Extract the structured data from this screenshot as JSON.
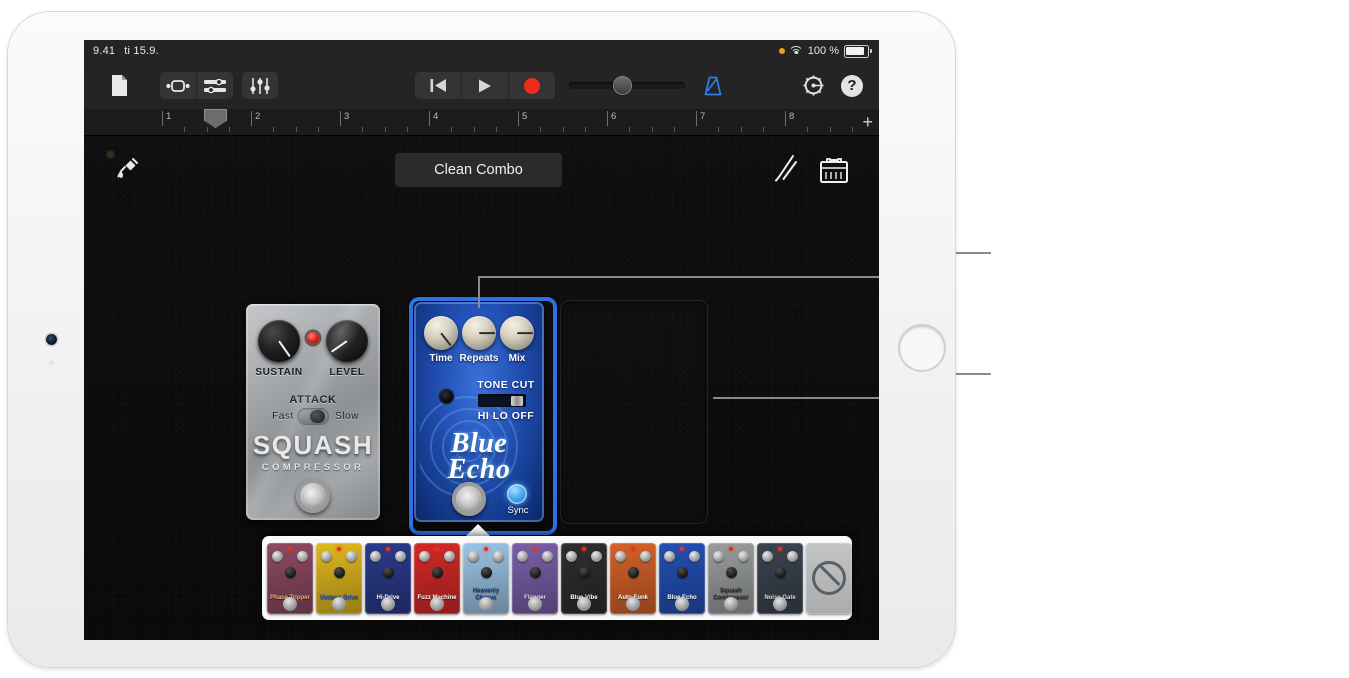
{
  "status_bar": {
    "time": "9.41",
    "date": "ti 15.9.",
    "battery_percent": "100 %",
    "wifi_icon": "wifi-icon",
    "recording_dot_icon": "orange-dot-icon",
    "battery_icon": "battery-full-icon"
  },
  "toolbar": {
    "navigation_icon": "document-icon",
    "loops_icon": "loop-browser-icon",
    "tracks_icon": "track-view-icon",
    "mixer_icon": "mixer-faders-icon",
    "rewind_icon": "rewind-icon",
    "play_icon": "play-icon",
    "record_icon": "record-icon",
    "volume_label": "master-volume-slider",
    "metronome_icon": "metronome-icon",
    "settings_icon": "gear-icon",
    "help_label": "?"
  },
  "ruler": {
    "bars": [
      "1",
      "2",
      "3",
      "4",
      "5",
      "6",
      "7",
      "8"
    ],
    "add_label": "+",
    "playhead_icon": "playhead-marker"
  },
  "amp_header": {
    "input_icon": "guitar-cable-icon",
    "preset_name": "Clean Combo",
    "tuner_icon": "tuning-fork-icon",
    "amp_icon": "amp-stack-icon",
    "input_led_icon": "input-led"
  },
  "pedals": [
    {
      "id": "squash-compressor",
      "name": "SQUASH",
      "subtitle": "COMPRESSOR",
      "selected": false,
      "knobs": [
        {
          "label": "SUSTAIN",
          "angle": -35
        },
        {
          "label": "LEVEL",
          "angle": 55
        }
      ],
      "led_icon": "red-led",
      "switch": {
        "label": "ATTACK",
        "left_option": "Fast",
        "right_option": "Slow",
        "position": "Slow"
      },
      "footswitch_icon": "footswitch-icon"
    },
    {
      "id": "blue-echo",
      "name": "Blue",
      "name_line2": "Echo",
      "selected": true,
      "knobs": [
        {
          "label": "Time",
          "angle": -38
        },
        {
          "label": "Repeats",
          "angle": -90
        },
        {
          "label": "Mix",
          "angle": -90
        }
      ],
      "tone_cut": {
        "title": "TONE CUT",
        "options": "HI LO OFF",
        "position": "OFF"
      },
      "jack_icon": "input-jack-icon",
      "sync_label": "Sync",
      "sync_on": true,
      "footswitch_icon": "footswitch-icon"
    }
  ],
  "empty_slot": {
    "name": "empty-pedal-slot"
  },
  "browser": {
    "items": [
      {
        "name": "Phase Tripper",
        "color": "#8d4a63",
        "text_color": "#f0b070"
      },
      {
        "name": "Vintage Drive",
        "color": "#e0b81e",
        "text_color": "#2b4aa8"
      },
      {
        "name": "Hi-Drive",
        "color": "#2a3a8a",
        "text_color": "#ffffff"
      },
      {
        "name": "Fuzz Machine",
        "color": "#d32a28",
        "text_color": "#ffffff"
      },
      {
        "name": "Heavenly Chorus",
        "color": "#9cc4e4",
        "text_color": "#1d3f7a"
      },
      {
        "name": "Flanger",
        "color": "#7a5fa8",
        "text_color": "#e8e0f4"
      },
      {
        "name": "Blue Vibe",
        "color": "#2e2e2e",
        "text_color": "#ffffff"
      },
      {
        "name": "Auto-Funk",
        "color": "#d4622a",
        "text_color": "#ffffff"
      },
      {
        "name": "Blue Echo",
        "color": "#2350b4",
        "text_color": "#ffffff"
      },
      {
        "name": "Squash Compressor",
        "color": "#9a9d9f",
        "text_color": "#2a2a2a"
      },
      {
        "name": "Noise Gate",
        "color": "#3a4450",
        "text_color": "#dddddd"
      },
      {
        "name": "No Pedal",
        "color": "#b5b7b9",
        "text_color": "#5d6063",
        "icon": "no-pedal-icon"
      }
    ]
  },
  "callouts": {
    "upper": "callout-line-knob",
    "lower": "callout-line-empty-slot"
  },
  "device": {
    "camera_icon": "front-camera",
    "home_button_icon": "home-button"
  }
}
